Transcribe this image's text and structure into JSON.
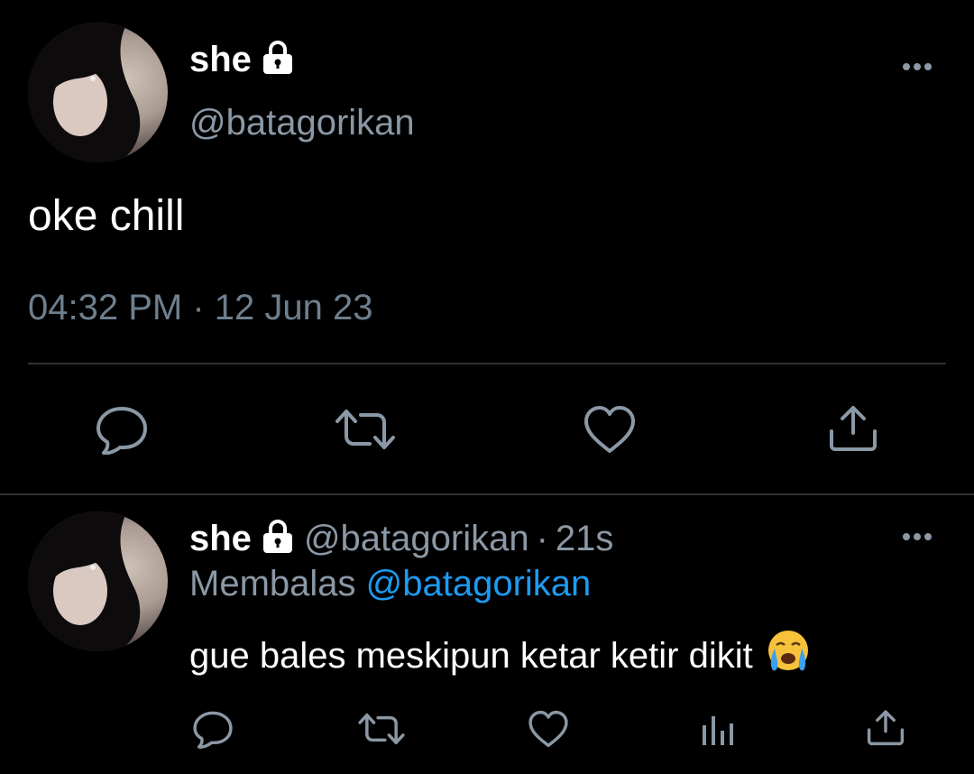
{
  "main_tweet": {
    "name": "she",
    "handle": "@batagorikan",
    "text": "oke chill",
    "timestamp": "04:32 PM · 12 Jun 23",
    "icons": [
      "lock-icon",
      "more-icon",
      "reply-icon",
      "retweet-icon",
      "like-icon",
      "share-icon"
    ]
  },
  "reply_tweet": {
    "name": "she",
    "handle": "@batagorikan",
    "separator": "·",
    "age": "21s",
    "replying_prefix": "Membalas",
    "replying_to": "@batagorikan",
    "text": "gue bales meskipun ketar ketir dikit",
    "emoji": "😭",
    "icons": [
      "lock-icon",
      "more-icon",
      "reply-icon",
      "retweet-icon",
      "like-icon",
      "analytics-icon",
      "share-icon"
    ]
  },
  "colors": {
    "background": "#000000",
    "text": "#ffffff",
    "secondary": "#8b98a5",
    "link": "#1d9bf0",
    "divider": "#2f3336"
  }
}
